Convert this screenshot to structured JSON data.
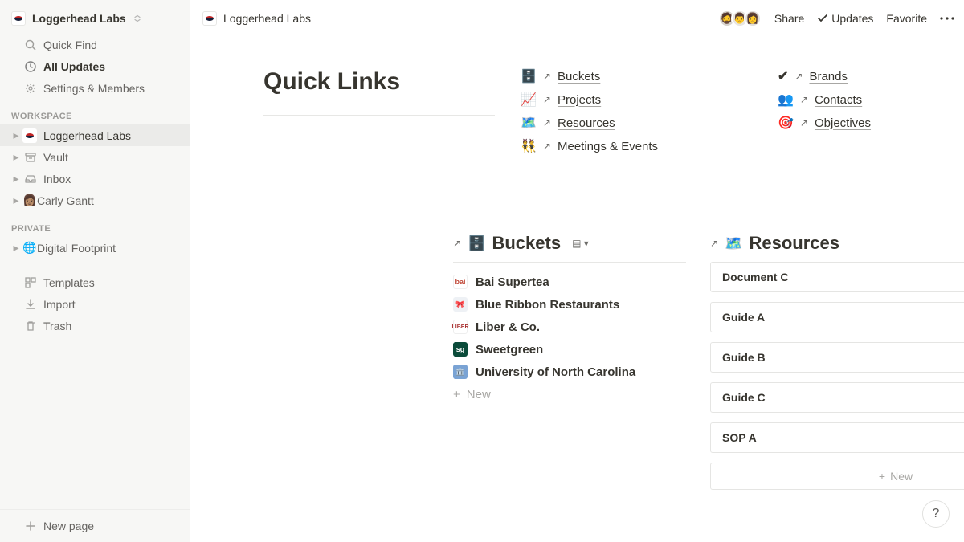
{
  "workspace_name": "Loggerhead Labs",
  "sidebar": {
    "quicknav": [
      {
        "label": "Quick Find"
      },
      {
        "label": "All Updates"
      },
      {
        "label": "Settings & Members"
      }
    ],
    "labels": {
      "workspace": "WORKSPACE",
      "private": "PRIVATE"
    },
    "workspace_pages": [
      {
        "label": "Loggerhead Labs"
      },
      {
        "label": "Vault"
      },
      {
        "label": "Inbox"
      },
      {
        "label": "Carly Gantt"
      }
    ],
    "private_pages": [
      {
        "label": "Digital Footprint"
      }
    ],
    "utility": [
      {
        "label": "Templates"
      },
      {
        "label": "Import"
      },
      {
        "label": "Trash"
      }
    ],
    "new_page": "New page"
  },
  "breadcrumb": "Loggerhead Labs",
  "topbar": {
    "share": "Share",
    "updates": "Updates",
    "favorite": "Favorite"
  },
  "quicklinks": {
    "title": "Quick Links",
    "col1": [
      {
        "emoji": "🗄️",
        "label": "Buckets"
      },
      {
        "emoji": "📈",
        "label": "Projects"
      },
      {
        "emoji": "🗺️",
        "label": "Resources"
      },
      {
        "emoji": "👯",
        "label": "Meetings & Events"
      }
    ],
    "col2": [
      {
        "emoji": "✔︎",
        "label": "Brands"
      },
      {
        "emoji": "👥",
        "label": "Contacts"
      },
      {
        "emoji": "🎯",
        "label": "Objectives"
      }
    ]
  },
  "buckets": {
    "title": "Buckets",
    "items": [
      {
        "label": "Bai Supertea"
      },
      {
        "label": "Blue Ribbon Restaurants"
      },
      {
        "label": "Liber & Co."
      },
      {
        "label": "Sweetgreen"
      },
      {
        "label": "University of North Carolina"
      }
    ],
    "new": "New"
  },
  "resources": {
    "title": "Resources",
    "items": [
      {
        "label": "Document C"
      },
      {
        "label": "Guide A"
      },
      {
        "label": "Guide B"
      },
      {
        "label": "Guide C"
      },
      {
        "label": "SOP A"
      }
    ],
    "new": "New"
  }
}
